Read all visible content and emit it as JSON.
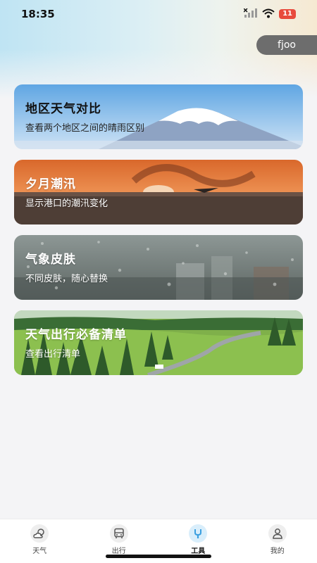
{
  "status": {
    "time": "18:35",
    "battery": "11"
  },
  "user": {
    "name": "fjoo"
  },
  "cards": [
    {
      "title": "地区天气对比",
      "subtitle": "查看两个地区之间的晴雨区别"
    },
    {
      "title": "夕月潮汛",
      "subtitle": "显示港口的潮汛变化"
    },
    {
      "title": "气象皮肤",
      "subtitle": "不同皮肤，随心替换"
    },
    {
      "title": "天气出行必备清单",
      "subtitle": "查看出行清单"
    }
  ],
  "nav": [
    {
      "label": "天气",
      "icon": "weather-icon"
    },
    {
      "label": "出行",
      "icon": "bus-icon"
    },
    {
      "label": "工具",
      "icon": "tool-icon",
      "active": true
    },
    {
      "label": "我的",
      "icon": "profile-icon"
    }
  ],
  "colors": {
    "accent": "#3a9fe0",
    "battery": "#e84a3c",
    "badge": "#6d6d6d"
  }
}
